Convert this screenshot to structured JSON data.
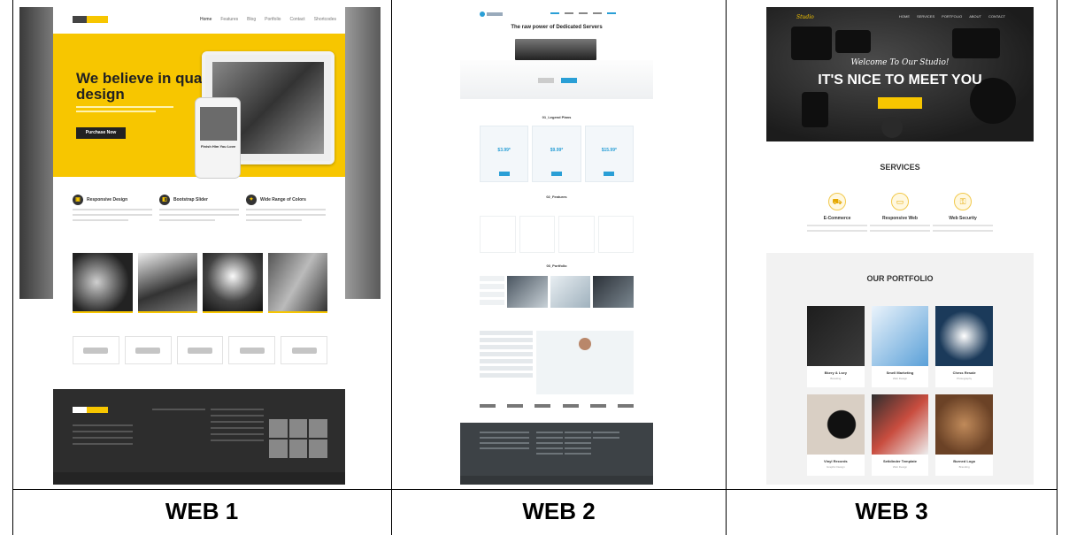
{
  "captions": {
    "web1": "WEB 1",
    "web2": "WEB 2",
    "web3": "WEB 3"
  },
  "web1": {
    "menu": [
      "Home",
      "Features",
      "Blog",
      "Portfolio",
      "Contact",
      "Shortcodes"
    ],
    "hero_title": "We believe in quality design",
    "hero_cta": "Purchase Now",
    "phone_text": "Finish Him You Love",
    "features": [
      "Responsive Design",
      "Bootstrap Slider",
      "Wide Range of Colors"
    ],
    "colors": {
      "accent": "#f7c600",
      "dark": "#2d2d2d"
    }
  },
  "web2": {
    "title": "The raw power of Dedicated Servers",
    "sections": [
      "01_Legend Plans",
      "02_Features",
      "03_Portfolio"
    ],
    "plan_prices": [
      "$3.99*",
      "$9.99*",
      "$15.99*"
    ],
    "colors": {
      "accent": "#2a9fd6",
      "footer": "#3d4246"
    }
  },
  "web3": {
    "menu": [
      "HOME",
      "SERVICES",
      "PORTFOLIO",
      "ABOUT",
      "CONTACT"
    ],
    "welcome": "Welcome To Our Studio!",
    "headline": "IT'S NICE TO MEET YOU",
    "services_title": "SERVICES",
    "services": [
      "E-Commerce",
      "Responsive Web",
      "Web Security"
    ],
    "portfolio_title": "OUR PORTFOLIO",
    "portfolio_items": [
      {
        "name": "Bkery & Lsey",
        "category": "Branding"
      },
      {
        "name": "Smell Marketing",
        "category": "Web Design"
      },
      {
        "name": "Chess Resale",
        "category": "Photography"
      },
      {
        "name": "Vinyl Records",
        "category": "Graphic Design"
      },
      {
        "name": "Setblinder Template",
        "category": "Web Design"
      },
      {
        "name": "Burned Logo",
        "category": "Branding"
      }
    ],
    "icons": [
      "cart-icon",
      "monitor-icon",
      "lock-icon"
    ],
    "colors": {
      "accent": "#f7c600"
    }
  }
}
